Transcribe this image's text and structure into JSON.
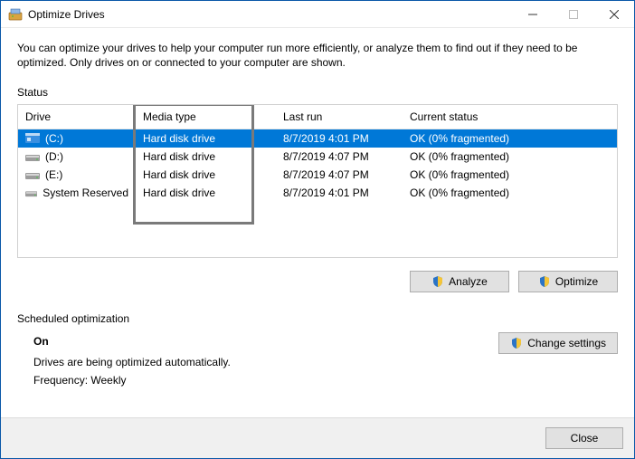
{
  "window": {
    "title": "Optimize Drives"
  },
  "intro": "You can optimize your drives to help your computer run more efficiently, or analyze them to find out if they need to be optimized. Only drives on or connected to your computer are shown.",
  "status": {
    "label": "Status",
    "columns": {
      "drive": "Drive",
      "media": "Media type",
      "last": "Last run",
      "status": "Current status"
    },
    "rows": [
      {
        "name": "(C:)",
        "media": "Hard disk drive",
        "last": "8/7/2019 4:01 PM",
        "status": "OK (0% fragmented)",
        "icon": "blue",
        "selected": true
      },
      {
        "name": "(D:)",
        "media": "Hard disk drive",
        "last": "8/7/2019 4:07 PM",
        "status": "OK (0% fragmented)",
        "icon": "gray",
        "selected": false
      },
      {
        "name": "(E:)",
        "media": "Hard disk drive",
        "last": "8/7/2019 4:07 PM",
        "status": "OK (0% fragmented)",
        "icon": "gray",
        "selected": false
      },
      {
        "name": "System Reserved",
        "media": "Hard disk drive",
        "last": "8/7/2019 4:01 PM",
        "status": "OK (0% fragmented)",
        "icon": "gray",
        "selected": false
      }
    ]
  },
  "buttons": {
    "analyze": "Analyze",
    "optimize": "Optimize",
    "change": "Change settings",
    "close": "Close"
  },
  "schedule": {
    "label": "Scheduled optimization",
    "state": "On",
    "desc": "Drives are being optimized automatically.",
    "freq": "Frequency: Weekly"
  }
}
